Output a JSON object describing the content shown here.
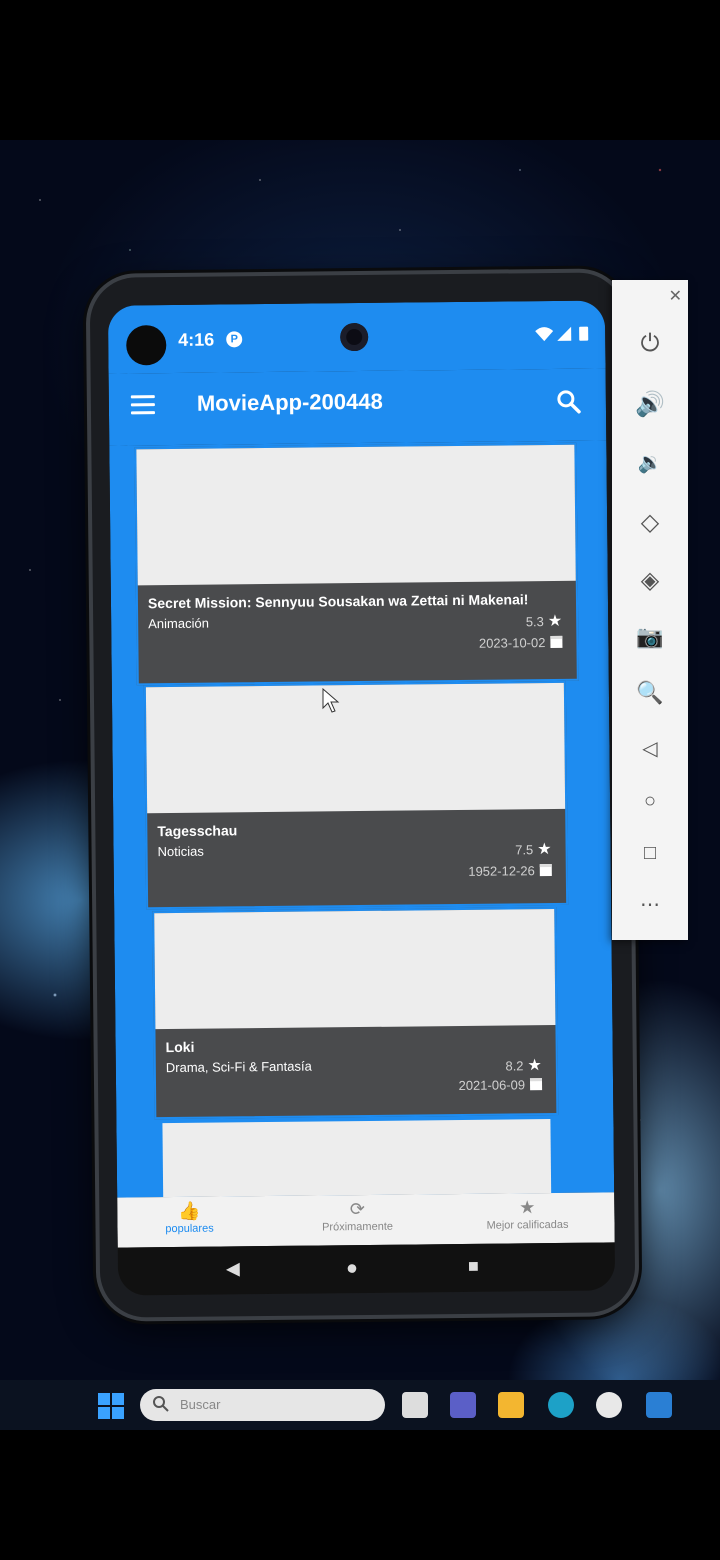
{
  "status_bar": {
    "time": "4:16",
    "badge": "P"
  },
  "app_bar": {
    "title": "MovieApp-200448"
  },
  "movies": [
    {
      "title": "Secret Mission: Sennyuu Sousakan wa Zettai ni Makenai!",
      "genre": "Animación",
      "rating": "5.3",
      "date": "2023-10-02"
    },
    {
      "title": "Tagesschau",
      "genre": "Noticias",
      "rating": "7.5",
      "date": "1952-12-26"
    },
    {
      "title": "Loki",
      "genre": "Drama, Sci-Fi & Fantasía",
      "rating": "8.2",
      "date": "2021-06-09"
    }
  ],
  "bottom_nav": [
    {
      "label": "populares",
      "icon": "thumbs-up-icon",
      "active": true
    },
    {
      "label": "Próximamente",
      "icon": "clock-icon",
      "active": false
    },
    {
      "label": "Mejor calificadas",
      "icon": "star-icon",
      "active": false
    }
  ],
  "taskbar": {
    "search_placeholder": "Buscar"
  },
  "colors": {
    "primary": "#1e8cf0",
    "card_info": "#4a4b4d",
    "poster": "#ededed"
  }
}
